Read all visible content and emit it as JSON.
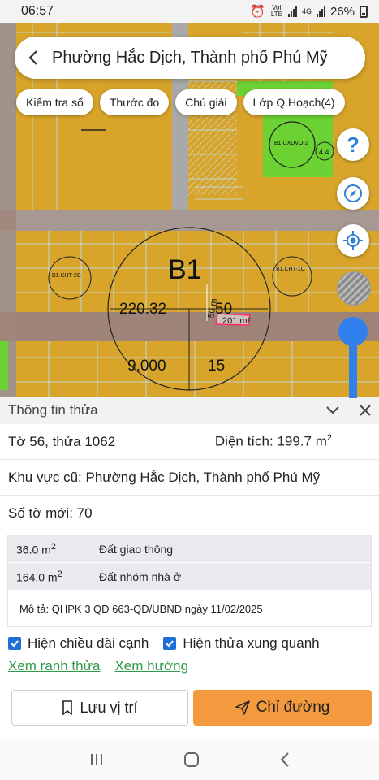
{
  "status": {
    "time": "06:57",
    "net1": "VoI LTE",
    "net2": "4G",
    "battery": "26%"
  },
  "header": {
    "title": "Phường Hắc Dịch, Thành phố Phú Mỹ"
  },
  "chips": [
    {
      "label": "Kiểm tra sổ"
    },
    {
      "label": "Thước đo"
    },
    {
      "label": "Chú giải"
    },
    {
      "label": "Lớp Q.Hoạch(4)"
    }
  ],
  "map_labels": {
    "zone": "B1",
    "block_code_left": "B1.CHT-2C",
    "block_code_right": "B1.CHT-1C",
    "block_code_green": "B1.CXDVO-2",
    "green_number": "4.4",
    "area_number": "220.32",
    "area_suffix": "50",
    "distance": "50 m",
    "parcel_area": "201 m²",
    "lower_left_number": "9.000",
    "lower_right_number": "15"
  },
  "sheet": {
    "title": "Thông tin thửa",
    "parcel_label": "Tờ 56, thửa 1062",
    "area_label": "Diện tích: 199.7 m",
    "area_sup": "2",
    "old_area": "Khu vực cũ: Phường Hắc Dịch, Thành phố Phú Mỹ",
    "new_sheet": "Số tờ mới: 70",
    "land_use": [
      {
        "area": "36.0 m",
        "sup": "2",
        "type": "Đất giao thông"
      },
      {
        "area": "164.0 m",
        "sup": "2",
        "type": "Đất nhóm nhà ở"
      }
    ],
    "description": "Mô tả: QHPK 3 QĐ 663-QĐ/UBND ngày 11/02/2025",
    "check_edge_length": "Hiện chiều dài cạnh",
    "check_surrounding": "Hiện thửa xung quanh",
    "link_boundary": "Xem ranh thửa",
    "link_direction": "Xem hướng",
    "save_label": "Lưu vị trí",
    "route_label": "Chỉ đường"
  },
  "colors": {
    "accent_orange": "#f49a3e",
    "accent_blue": "#2f80ed",
    "link_green": "#2e9a4a",
    "map_yellow": "#d8a52a"
  }
}
